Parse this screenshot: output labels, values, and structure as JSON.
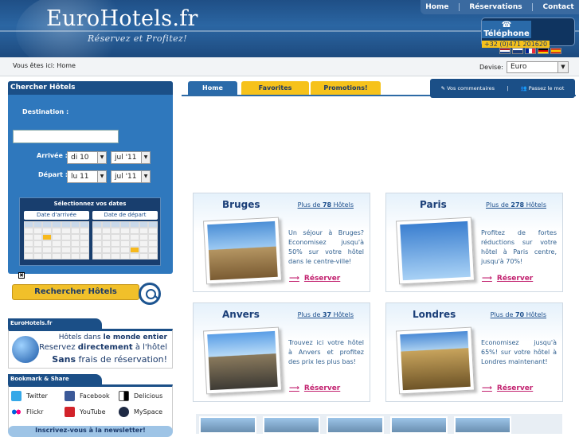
{
  "header": {
    "logo": "EuroHotels.fr",
    "slogan": "Réservez et Profitez!",
    "nav": [
      "Home",
      "Réservations",
      "Contact"
    ],
    "phone_label": "Téléphone",
    "phone_number": "+32 (0)471 201620"
  },
  "breadcrumb": "Vous êtes ici: Home",
  "devise": {
    "label": "Devise:",
    "value": "Euro"
  },
  "flags": [
    "nl",
    "en",
    "fr",
    "de",
    "es"
  ],
  "search": {
    "title": "Chercher Hôtels",
    "destination_label": "Destination :",
    "arrivee_label": "Arrivée :",
    "arrivee_day": "di 10",
    "arrivee_month": "jul '11",
    "depart_label": "Départ :",
    "depart_day": "lu 11",
    "depart_month": "jul '11",
    "calendar_title": "Sélectionnez vos dates",
    "cal_arrival": "Date d'arrivée",
    "cal_departure": "Date de départ",
    "button": "Rechercher Hôtels"
  },
  "promo": {
    "section": "EuroHotels.fr",
    "line1a": "Hôtels dans ",
    "line1b": "le monde entier",
    "line2a": "Reservez ",
    "line2b": "directement",
    "line2c": " à l'hôtel",
    "line3a": "Sans",
    "line3b": " frais de réservation!"
  },
  "bookmark": {
    "section": "Bookmark & Share",
    "items": [
      "Twitter",
      "Facebook",
      "Delicious",
      "Flickr",
      "YouTube",
      "MySpace"
    ]
  },
  "newsletter": "Inscrivez-vous à la newsletter!",
  "tabs": [
    "Home",
    "Favorites",
    "Promotions!"
  ],
  "right_tab": {
    "comments": "Vos commentaires",
    "pass": "Passez le mot"
  },
  "cities": [
    {
      "name": "Bruges",
      "more_pre": "Plus de ",
      "count": "78",
      "more_post": " Hôtels",
      "desc": "Un séjour à Bruges? Economisez jusqu'à 50% sur votre hôtel dans le centre-ville!",
      "reserve": "Réserver"
    },
    {
      "name": "Paris",
      "more_pre": "Plus de ",
      "count": "278",
      "more_post": " Hôtels",
      "desc": "Profitez de fortes réductions sur votre hôtel à Paris centre, jusqu'à 70%!",
      "reserve": "Réserver"
    },
    {
      "name": "Anvers",
      "more_pre": "Plus de ",
      "count": "37",
      "more_post": " Hôtels",
      "desc": "Trouvez ici votre hôtel à Anvers et profitez des prix les plus bas!",
      "reserve": "Réserver"
    },
    {
      "name": "Londres",
      "more_pre": "Plus de ",
      "count": "70",
      "more_post": " Hôtels",
      "desc": "Economisez jusqu'à 65%! sur votre hôtel à Londres maintenant!",
      "reserve": "Réserver"
    }
  ]
}
